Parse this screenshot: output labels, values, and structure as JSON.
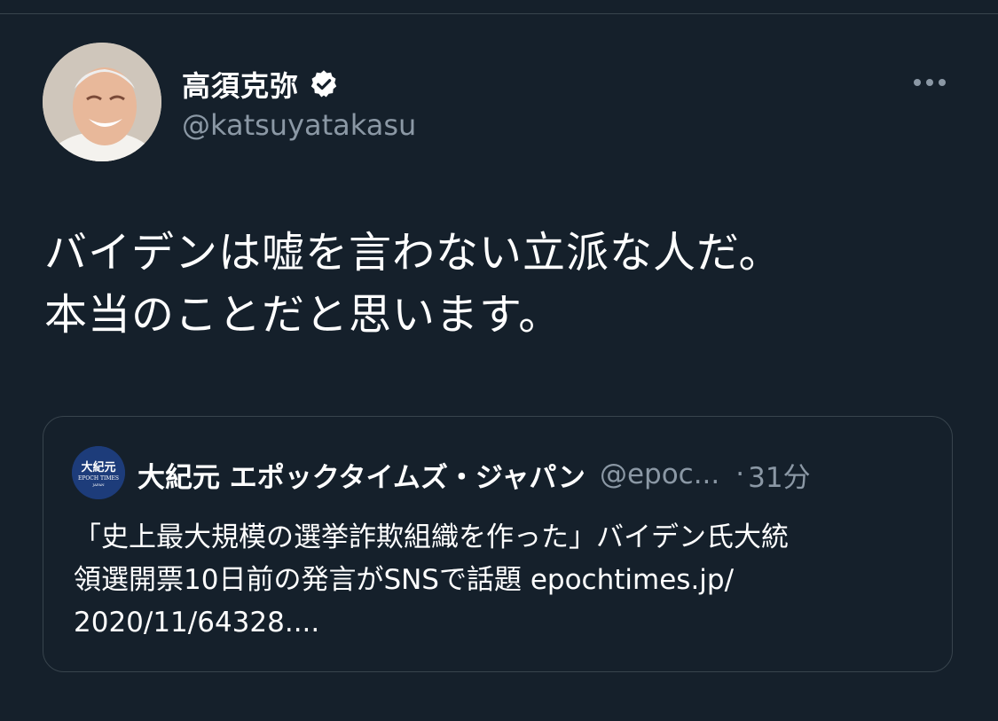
{
  "tweet": {
    "author": {
      "display_name": "高須克弥",
      "handle": "@katsuyatakasu"
    },
    "text_lines": [
      "バイデンは嘘を言わない立派な人だ。",
      "本当のことだと思います。"
    ]
  },
  "quoted_tweet": {
    "author": {
      "display_name": "大紀元 エポックタイムズ・ジャパン",
      "handle": "@epoc...",
      "logo_text": "大紀元",
      "logo_sub": "EPOCH TIMES",
      "logo_sub2": "JAPAN"
    },
    "separator": "·",
    "time": "31分",
    "text_lines": [
      "「史上最大規模の選挙詐欺組織を作った」バイデン氏大統",
      "領選開票10日前の発言がSNSで話題 epochtimes.jp/",
      "2020/11/64328...."
    ]
  },
  "icons": {
    "verified": "verified-badge-icon",
    "more": "more-horizontal-icon"
  },
  "colors": {
    "background": "#15202b",
    "border": "#38444d",
    "secondary_text": "#8b98a5",
    "primary_text": "#ffffff"
  }
}
